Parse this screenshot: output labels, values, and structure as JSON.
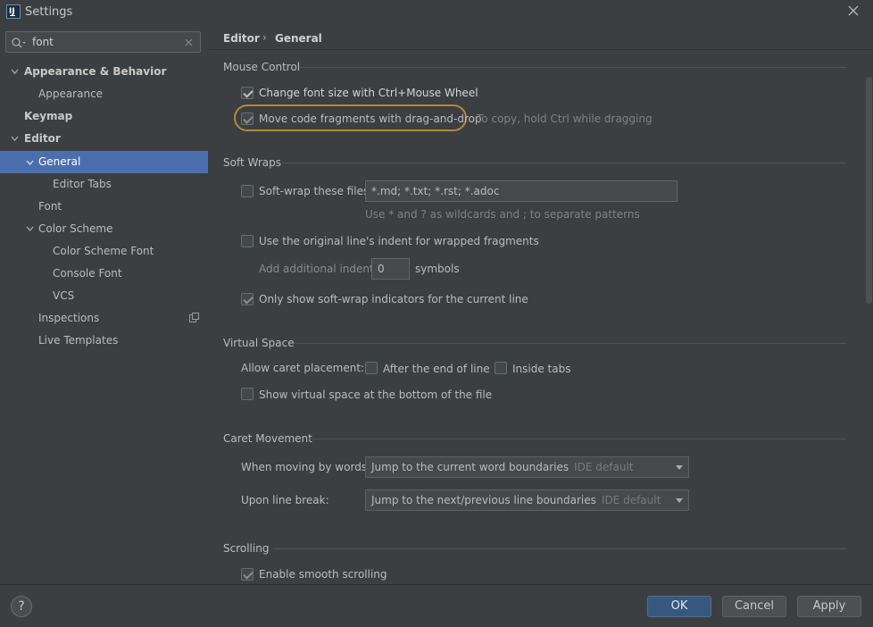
{
  "window": {
    "title": "Settings",
    "app_icon": "IJ"
  },
  "search": {
    "value": "font",
    "icon": "search-icon",
    "clear_icon": "close-icon"
  },
  "tree": [
    {
      "label": "Appearance & Behavior",
      "bold": true,
      "expanded": true
    },
    {
      "label": "Appearance"
    },
    {
      "label": "Keymap",
      "bold": true
    },
    {
      "label": "Editor",
      "bold": true,
      "expanded": true
    },
    {
      "label": "General",
      "expanded": true,
      "selected": true
    },
    {
      "label": "Editor Tabs"
    },
    {
      "label": "Font"
    },
    {
      "label": "Color Scheme",
      "expanded": true
    },
    {
      "label": "Color Scheme Font"
    },
    {
      "label": "Console Font"
    },
    {
      "label": "VCS"
    },
    {
      "label": "Inspections",
      "icon": "copy-icon"
    },
    {
      "label": "Live Templates"
    }
  ],
  "breadcrumb": {
    "first": "Editor",
    "separator": "›",
    "second": "General"
  },
  "mouse_control": {
    "title": "Mouse Control",
    "change_font": {
      "label": "Change font size with Ctrl+Mouse Wheel",
      "checked": true
    },
    "drag_drop": {
      "label": "Move code fragments with drag-and-drop",
      "checked": true,
      "hint": "To copy, hold Ctrl while dragging"
    }
  },
  "soft_wraps": {
    "title": "Soft Wraps",
    "soft_wrap_files": {
      "label": "Soft-wrap these files:",
      "checked": false,
      "value": "*.md; *.txt; *.rst; *.adoc"
    },
    "patterns_hint": "Use * and ? as wildcards and ; to separate patterns",
    "original_indent": {
      "label": "Use the original line's indent for wrapped fragments",
      "checked": false
    },
    "additional_indent": {
      "label": "Add additional indent:",
      "value": "0",
      "unit": "symbols"
    },
    "indicators": {
      "label": "Only show soft-wrap indicators for the current line",
      "checked": true
    }
  },
  "virtual_space": {
    "title": "Virtual Space",
    "caret_label": "Allow caret placement:",
    "after_end": {
      "label": "After the end of line",
      "checked": false
    },
    "inside_tabs": {
      "label": "Inside tabs",
      "checked": false
    },
    "show_bottom": {
      "label": "Show virtual space at the bottom of the file",
      "checked": false
    }
  },
  "caret_movement": {
    "title": "Caret Movement",
    "words": {
      "label": "When moving by words:",
      "value": "Jump to the current word boundaries",
      "suffix": "IDE default"
    },
    "line_break": {
      "label": "Upon line break:",
      "value": "Jump to the next/previous line boundaries",
      "suffix": "IDE default"
    }
  },
  "scrolling": {
    "title": "Scrolling",
    "smooth": {
      "label": "Enable smooth scrolling",
      "checked": true
    }
  },
  "footer": {
    "help": "?",
    "ok": "OK",
    "cancel": "Cancel",
    "apply": "Apply"
  },
  "colors": {
    "selection": "#4b6eaf",
    "highlight": "#b08a3a",
    "primary_button": "#365880"
  }
}
